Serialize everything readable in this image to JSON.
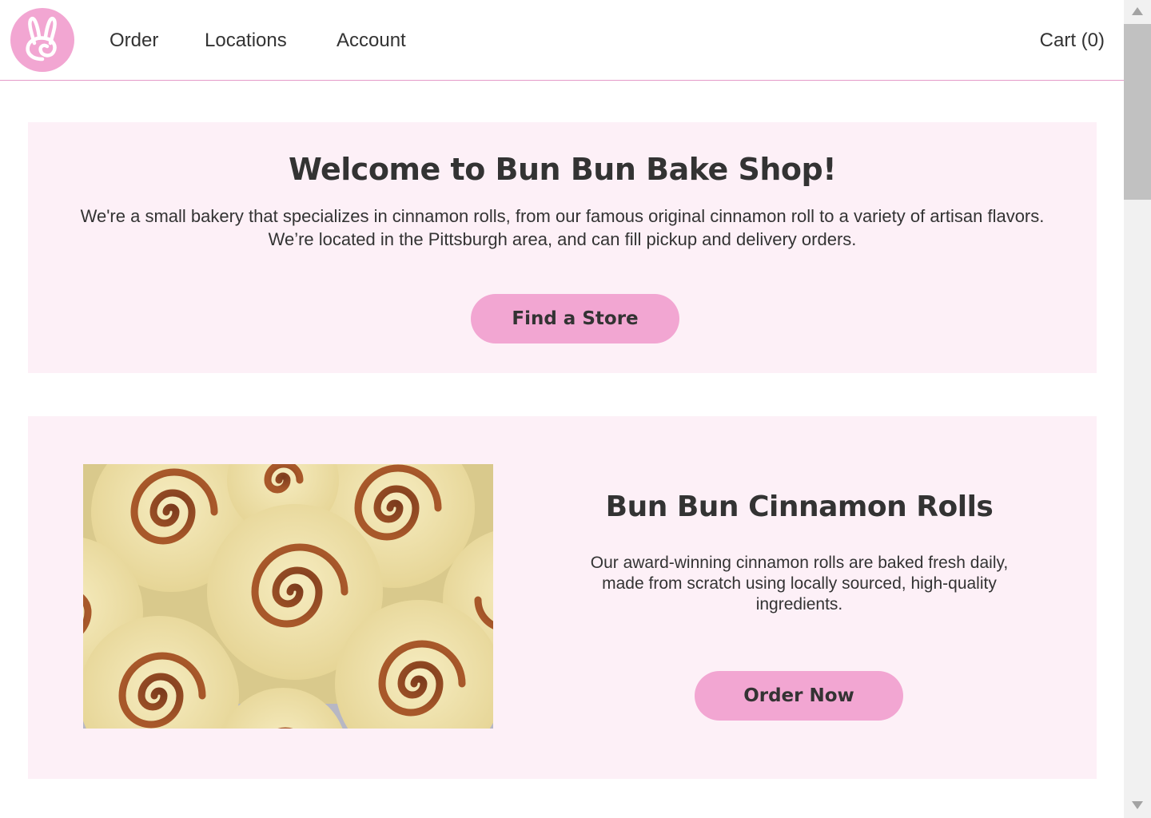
{
  "header": {
    "nav": {
      "order": "Order",
      "locations": "Locations",
      "account": "Account"
    },
    "cart_label": "Cart (0)",
    "logo_icon": "bunny-swirl-logo-icon"
  },
  "welcome": {
    "title": "Welcome to Bun Bun Bake Shop!",
    "line1": "We're a small bakery that specializes in cinnamon rolls, from our famous original cinnamon roll to a variety of artisan flavors.",
    "line2": "We’re located in the Pittsburgh area, and can fill pickup and delivery orders.",
    "button_label": "Find a Store"
  },
  "product": {
    "title": "Bun Bun Cinnamon Rolls",
    "line1": "Our award-winning cinnamon rolls are baked fresh daily,",
    "line2": "made from scratch using locally sourced, high-quality",
    "line3": "ingredients.",
    "button_label": "Order Now"
  },
  "colors": {
    "accent": "#f2a6d2",
    "section_bg": "#fdf0f7",
    "divider": "#e59bc9",
    "text": "#333333"
  }
}
